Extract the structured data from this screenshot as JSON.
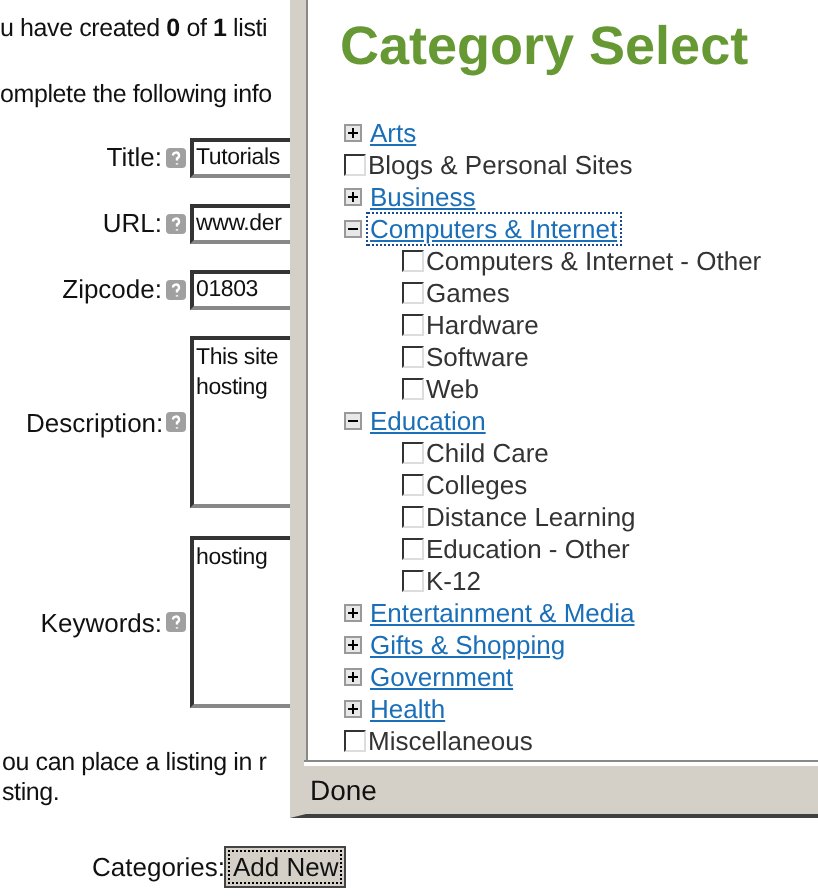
{
  "page": {
    "intro": "u have created **0** of **1** listi",
    "instruction": "omplete the following info",
    "fields": [
      {
        "label": "Title:",
        "kind": "input",
        "value": "Tutorials"
      },
      {
        "label": "URL:",
        "kind": "input",
        "value": "www.der"
      },
      {
        "label": "Zipcode:",
        "kind": "input",
        "value": "01803"
      },
      {
        "label": "Description:",
        "kind": "textarea",
        "value": "This site\nhosting"
      },
      {
        "label": "Keywords:",
        "kind": "textarea",
        "value": "hosting"
      }
    ],
    "note": "ou can place a listing in r\nsting.",
    "categories_label": "Categories:",
    "add_button": "Add New"
  },
  "popup": {
    "title": "Category Select",
    "status": "Done",
    "tree": [
      {
        "kind": "category",
        "label": "Arts",
        "expanded": false,
        "focused": false
      },
      {
        "kind": "leaf",
        "label": "Blogs & Personal Sites",
        "checked": false
      },
      {
        "kind": "category",
        "label": "Business",
        "expanded": false,
        "focused": false
      },
      {
        "kind": "category",
        "label": "Computers & Internet",
        "expanded": true,
        "focused": true,
        "children": [
          {
            "kind": "leaf",
            "label": "Computers & Internet - Other",
            "checked": false
          },
          {
            "kind": "leaf",
            "label": "Games",
            "checked": false
          },
          {
            "kind": "leaf",
            "label": "Hardware",
            "checked": false
          },
          {
            "kind": "leaf",
            "label": "Software",
            "checked": false
          },
          {
            "kind": "leaf",
            "label": "Web",
            "checked": false
          }
        ]
      },
      {
        "kind": "category",
        "label": "Education",
        "expanded": true,
        "focused": false,
        "children": [
          {
            "kind": "leaf",
            "label": "Child Care",
            "checked": false
          },
          {
            "kind": "leaf",
            "label": "Colleges",
            "checked": false
          },
          {
            "kind": "leaf",
            "label": "Distance Learning",
            "checked": false
          },
          {
            "kind": "leaf",
            "label": "Education - Other",
            "checked": false
          },
          {
            "kind": "leaf",
            "label": "K-12",
            "checked": false
          }
        ]
      },
      {
        "kind": "category",
        "label": "Entertainment & Media",
        "expanded": false,
        "focused": false
      },
      {
        "kind": "category",
        "label": "Gifts & Shopping",
        "expanded": false,
        "focused": false
      },
      {
        "kind": "category",
        "label": "Government",
        "expanded": false,
        "focused": false
      },
      {
        "kind": "category",
        "label": "Health",
        "expanded": false,
        "focused": false
      },
      {
        "kind": "leaf",
        "label": "Miscellaneous",
        "checked": false
      }
    ]
  }
}
